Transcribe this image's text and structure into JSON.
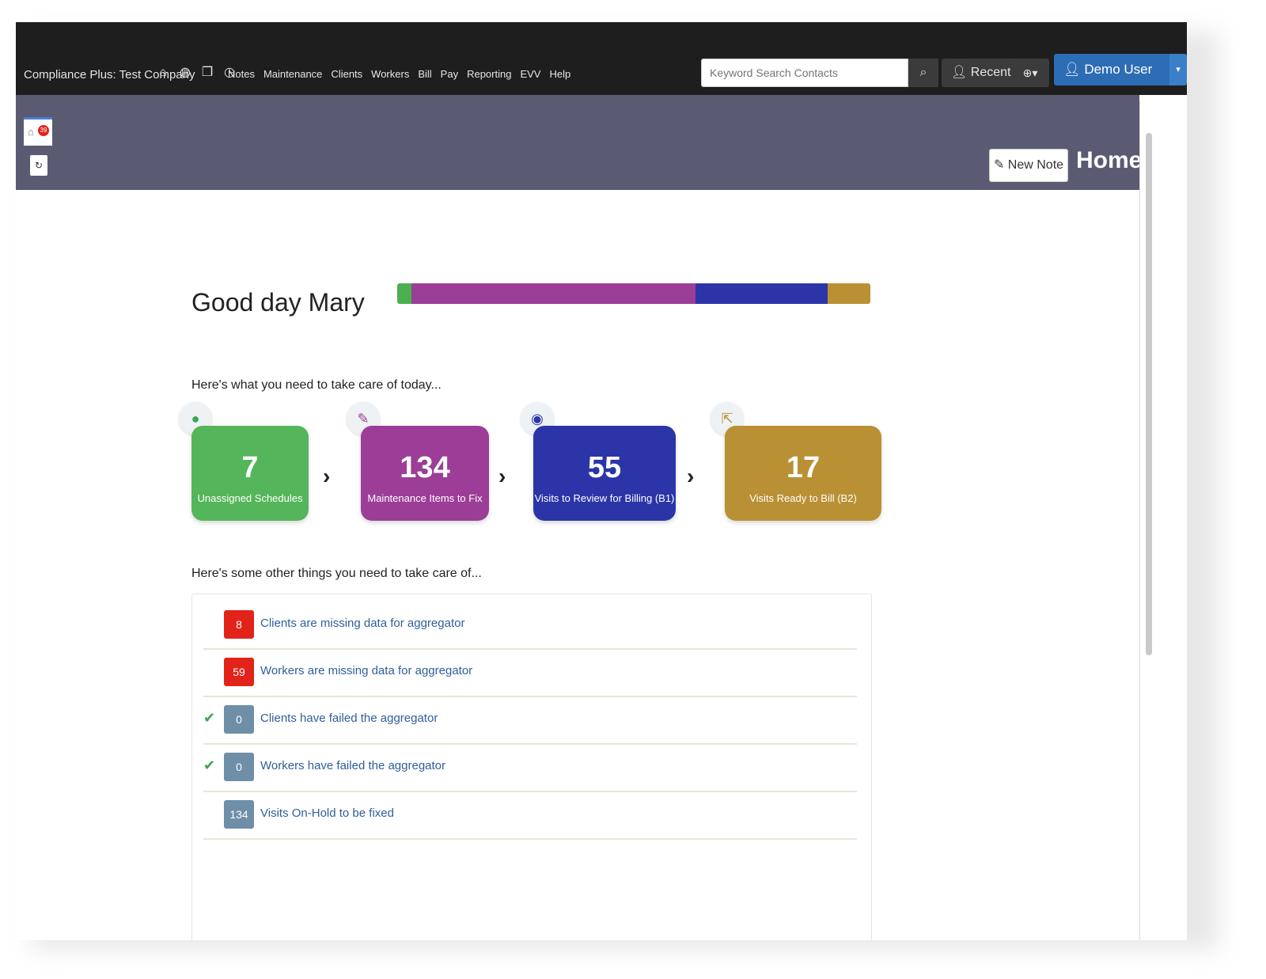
{
  "nav": {
    "brand": "Compliance Plus: Test Company",
    "icons": [
      "home-icon",
      "globe-icon",
      "windows-icon",
      "clock-icon"
    ],
    "menu": [
      "Notes",
      "Maintenance",
      "Clients",
      "Workers",
      "Bill",
      "Pay",
      "Reporting",
      "EVV",
      "Help"
    ],
    "search_placeholder": "Keyword Search Contacts",
    "recent_label": "Recent",
    "add_label": "⊕▾",
    "user_label": "Demo User",
    "user_caret": "▾"
  },
  "tab": {
    "badge": "39"
  },
  "header": {
    "new_note": "New Note",
    "title": "Home"
  },
  "greeting": "Good day Mary",
  "progress": [
    {
      "color": "#4caf50",
      "fraction": 0.03
    },
    {
      "color": "#9c3d97",
      "fraction": 0.6
    },
    {
      "color": "#2b35a8",
      "fraction": 0.28
    },
    {
      "color": "#b99034",
      "fraction": 0.09
    }
  ],
  "today_heading": "Here's what you need to take care of today...",
  "tasks": [
    {
      "value": "7",
      "label": "Unassigned Schedules",
      "color": "#55b55a",
      "icon": "user-icon",
      "icon_color": "#3aa655"
    },
    {
      "value": "134",
      "label": "Maintenance Items to Fix",
      "color": "#9c3d97",
      "icon": "wrench-icon",
      "icon_color": "#9c3d97"
    },
    {
      "value": "55",
      "label": "Visits to Review for Billing (B1)",
      "color": "#2b35a8",
      "icon": "eye-icon",
      "icon_color": "#2b35a8"
    },
    {
      "value": "17",
      "label": "Visits Ready to Bill (B2)",
      "color": "#b99034",
      "icon": "export-icon",
      "icon_color": "#b99034"
    }
  ],
  "other_heading": "Here's some other things you need to take care of...",
  "other_items": [
    {
      "count": "8",
      "label": "Clients are missing data for aggregator",
      "badge_color": "#e2231a",
      "checked": false
    },
    {
      "count": "59",
      "label": "Workers are missing data for aggregator",
      "badge_color": "#e2231a",
      "checked": false
    },
    {
      "count": "0",
      "label": "Clients have failed the aggregator",
      "badge_color": "#6f8ea8",
      "checked": true
    },
    {
      "count": "0",
      "label": "Workers have failed the aggregator",
      "badge_color": "#6f8ea8",
      "checked": true
    },
    {
      "count": "134",
      "label": "Visits On-Hold to be fixed",
      "badge_color": "#6f8ea8",
      "checked": false
    }
  ]
}
